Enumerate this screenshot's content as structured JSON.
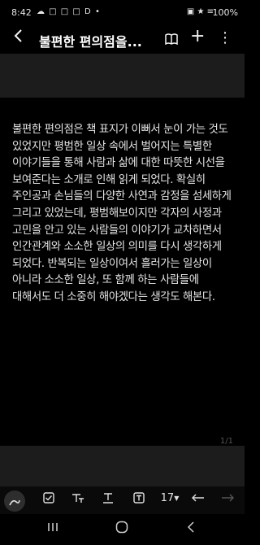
{
  "status_bar": {
    "time": "8:42",
    "notifications": "☁ □ □ □ D •",
    "system": "▣ ★ ≡",
    "battery": "100%"
  },
  "toolbar": {
    "title": "불편한 편의점을...",
    "back_icon": "back-arrow-icon",
    "book_icon": "book-icon",
    "add_icon": "plus-icon",
    "more_icon": "more-vert-icon"
  },
  "note": {
    "body": "불편한 편의점은 책 표지가 이뻐서 눈이 가는 것도 있었지만 평범한 일상 속에서 벌어지는 특별한 이야기들을 통해 사람과 삶에 대한 따뜻한 시선을 보여준다는 소개로 인해 읽게 되었다. 확실히 주인공과 손님들의 다양한 사연과 감정을 섬세하게 그리고 있었는데, 평범해보이지만 각자의 사정과 고민을 안고 있는 사람들의 이야기가 교차하면서 인간관계와 소소한 일상의 의미를 다시 생각하게 되었다. 반복되는 일상이여서 흘러가는 일상이 아니라 소소한 일상, 또 함께 하는 사람들에 대해서도 더 소중히 해야겠다는 생각도 해본다.",
    "page_indicator": "1/1"
  },
  "format_bar": {
    "pen_icon": "pen-icon",
    "checkbox_icon": "checkbox-icon",
    "text_style_icon": "text-style-icon",
    "text_format_icon": "text-format-icon",
    "text_box_icon": "text-box-icon",
    "font_size": "17",
    "undo_icon": "undo-icon",
    "redo_icon": "redo-icon"
  },
  "colors": {
    "background": "#000000",
    "band": "#1c1c1c",
    "text": "#e6e6e6"
  }
}
